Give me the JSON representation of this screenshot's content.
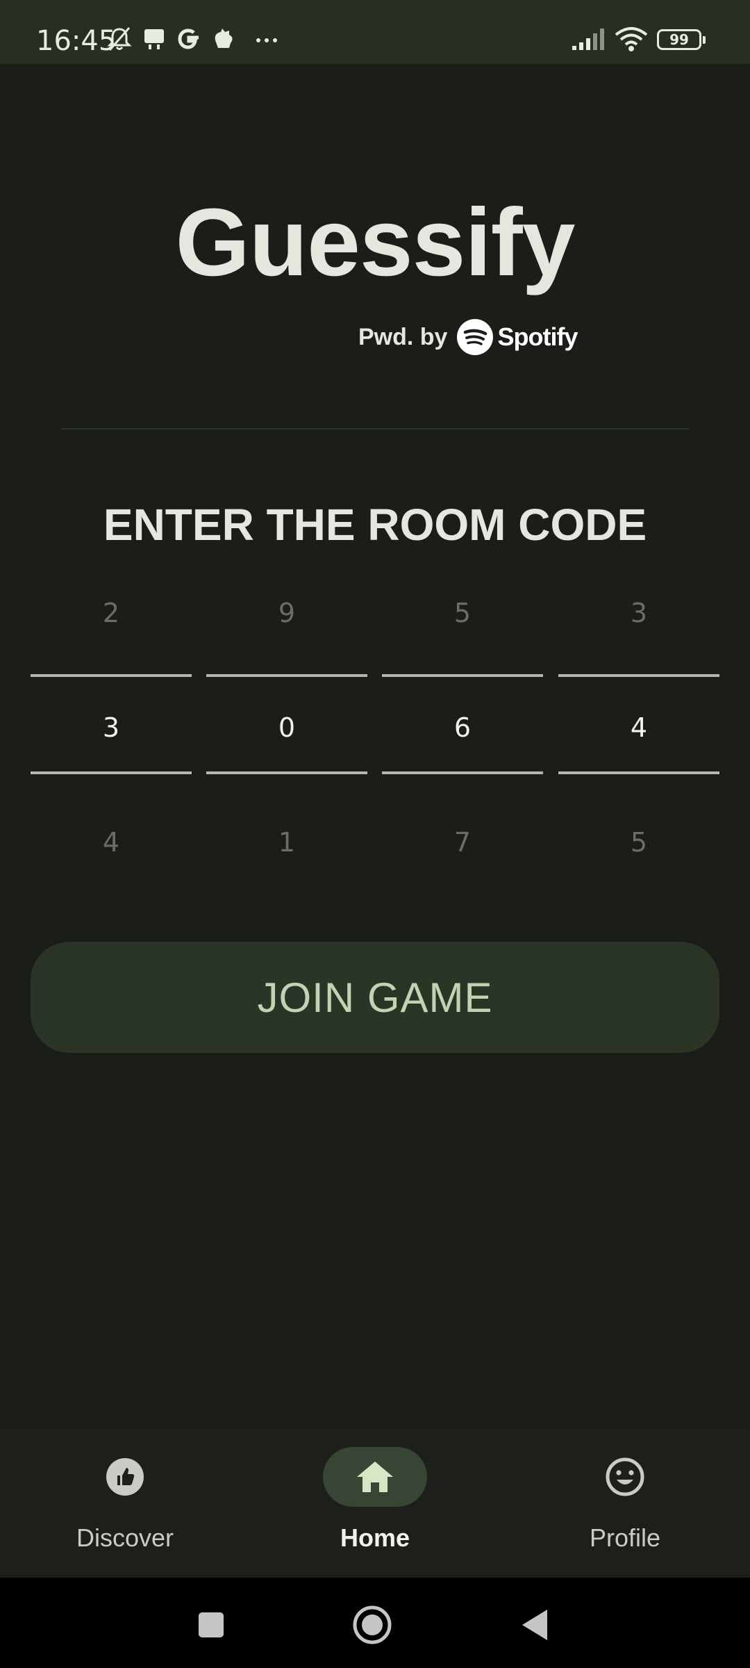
{
  "status_bar": {
    "time": "16:45",
    "left_icons": [
      "bell-off-icon",
      "notification-icon",
      "google-icon",
      "app-icon",
      "more-icon"
    ],
    "battery_level": "99",
    "right_icons": [
      "signal-icon",
      "wifi-icon",
      "battery-icon"
    ]
  },
  "header": {
    "app_title": "Guessify",
    "powered_by_label": "Pwd. by",
    "powered_by_brand": "Spotify"
  },
  "room_code": {
    "heading": "ENTER THE ROOM CODE",
    "columns": [
      {
        "prev": "2",
        "current": "3",
        "next": "4"
      },
      {
        "prev": "9",
        "current": "0",
        "next": "1"
      },
      {
        "prev": "5",
        "current": "6",
        "next": "7"
      },
      {
        "prev": "3",
        "current": "4",
        "next": "5"
      }
    ]
  },
  "join_button_label": "JOIN GAME",
  "bottom_nav": {
    "items": [
      {
        "label": "Discover",
        "icon": "thumbs-up-icon",
        "active": false
      },
      {
        "label": "Home",
        "icon": "home-icon",
        "active": true
      },
      {
        "label": "Profile",
        "icon": "smiley-icon",
        "active": false
      }
    ]
  },
  "system_nav": [
    "recents-button",
    "home-button",
    "back-button"
  ],
  "colors": {
    "background": "#1b1d19",
    "status_bar": "#273020",
    "button_bg": "#2a3525",
    "button_text": "#c3d2b3",
    "nav_active_pill": "#384534"
  }
}
